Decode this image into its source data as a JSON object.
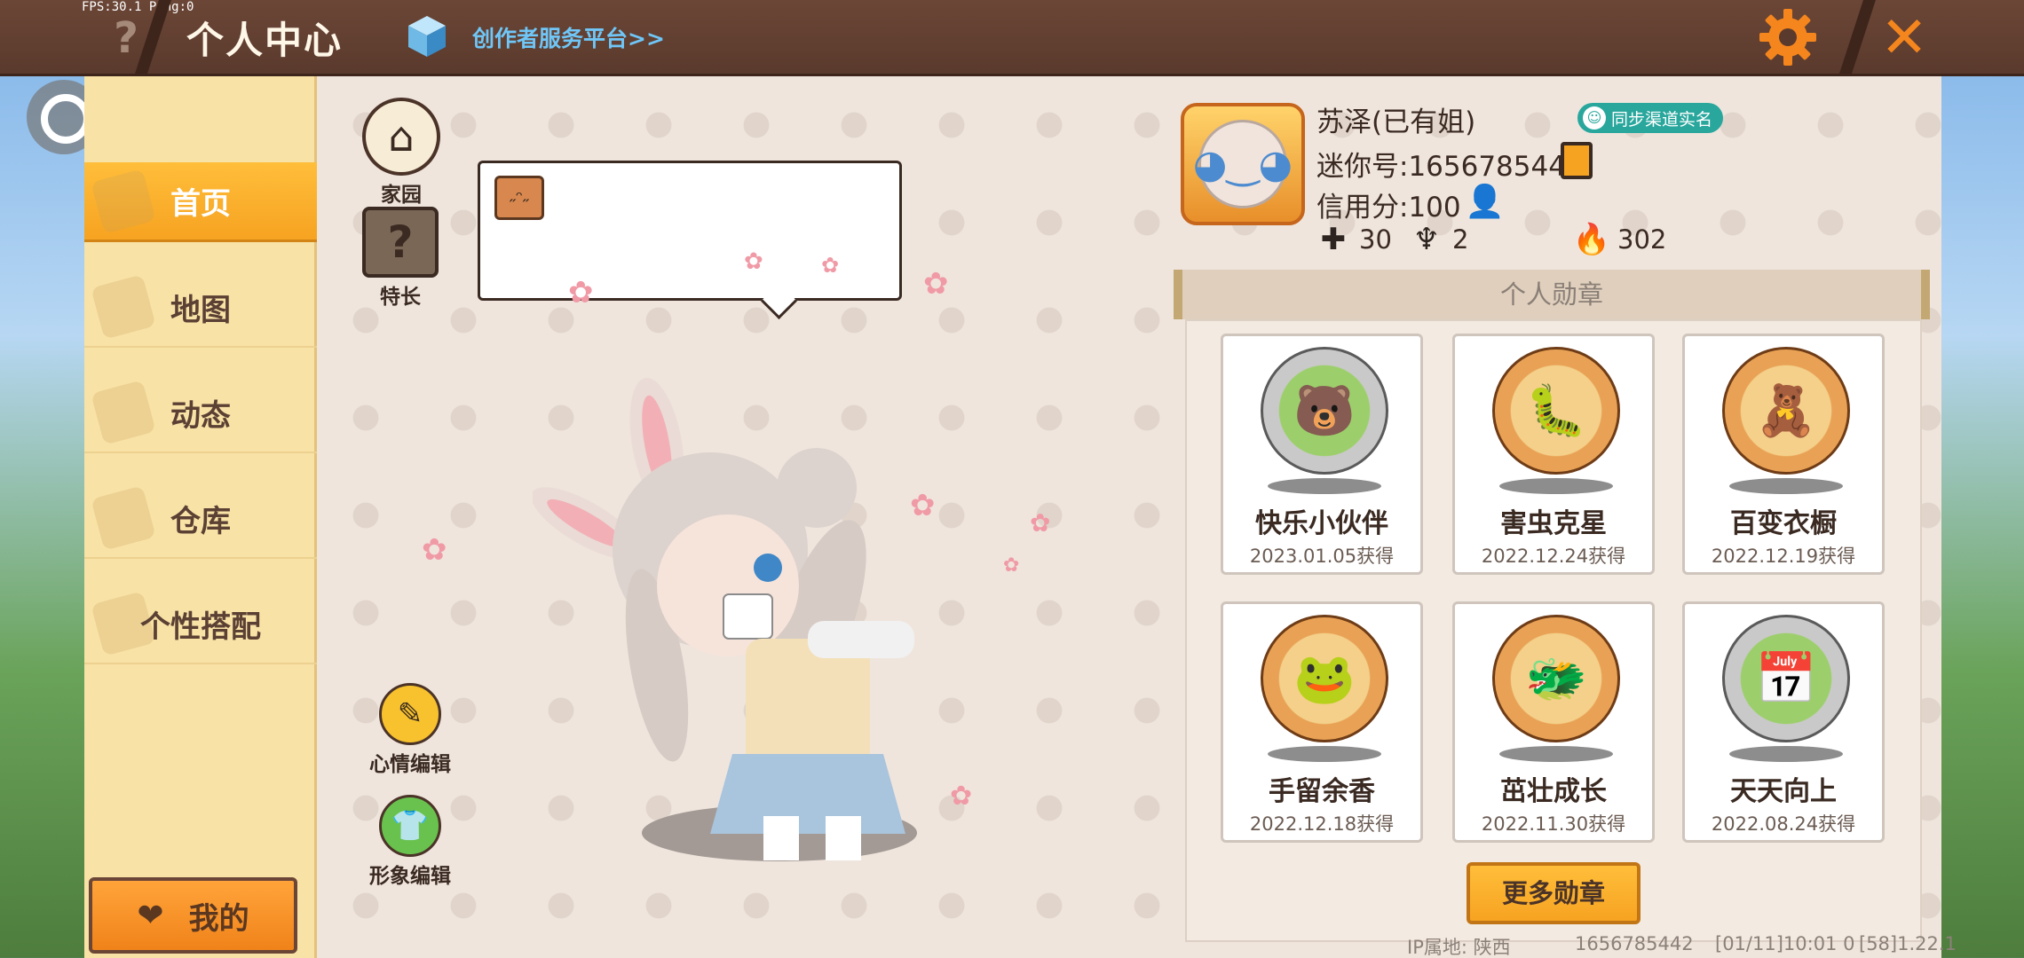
{
  "fps_ping": "FPS:30.1  Ping:0",
  "header": {
    "help_label": "?",
    "title": "个人中心",
    "creator_link": "创作者服务平台>>",
    "close_label": "✕"
  },
  "sidebar": {
    "items": [
      {
        "label": "首页",
        "active": true
      },
      {
        "label": "地图",
        "active": false
      },
      {
        "label": "动态",
        "active": false
      },
      {
        "label": "仓库",
        "active": false
      },
      {
        "label": "个性搭配",
        "active": false
      }
    ],
    "mine_label": "我的"
  },
  "left_tools": {
    "home_label": "家园",
    "talent_label": "特长",
    "talent_glyph": "?",
    "mood_label": "心情编辑",
    "look_label": "形象编辑"
  },
  "profile": {
    "name": "苏泽(已有姐)",
    "realname_button": "同步渠道实名",
    "mini_id": "迷你号:1656785442",
    "credit": "信用分:100",
    "stats": {
      "follow": "30",
      "fans": "2",
      "heat": "302"
    }
  },
  "medals": {
    "header": "个人勋章",
    "items": [
      {
        "name": "快乐小伙伴",
        "date": "2023.01.05获得",
        "tier": "silver",
        "icon": "🐻"
      },
      {
        "name": "害虫克星",
        "date": "2022.12.24获得",
        "tier": "bronze",
        "icon": "🐛"
      },
      {
        "name": "百变衣橱",
        "date": "2022.12.19获得",
        "tier": "bronze",
        "icon": "🧸"
      },
      {
        "name": "手留余香",
        "date": "2022.12.18获得",
        "tier": "bronze",
        "icon": "🐸"
      },
      {
        "name": "茁壮成长",
        "date": "2022.11.30获得",
        "tier": "bronze",
        "icon": "🐲"
      },
      {
        "name": "天天向上",
        "date": "2022.08.24获得",
        "tier": "silver",
        "icon": "📅"
      }
    ],
    "more_button": "更多勋章"
  },
  "footer": {
    "ip": "IP属地: 陕西",
    "id": "1656785442",
    "time": "[01/11]10:01 0",
    "version": "[58]1.22.1"
  },
  "colors": {
    "accent_orange": "#f6a321",
    "topbar_brown": "#5a3a2d",
    "sidebar_yellow": "#f9e2a6",
    "realname_teal": "#29a79d"
  }
}
